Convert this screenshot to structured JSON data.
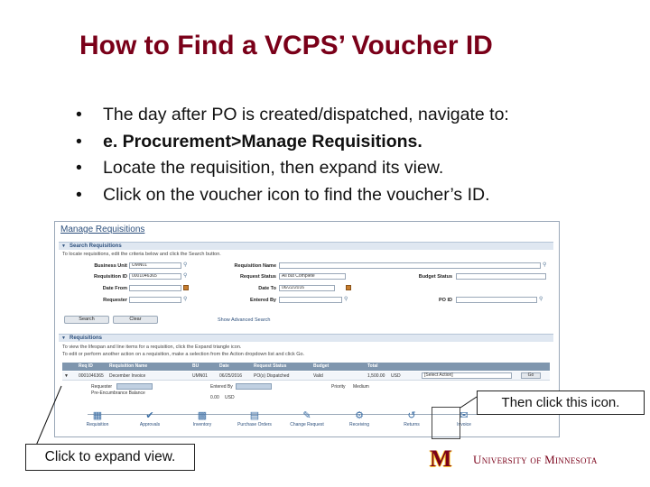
{
  "slide": {
    "title": "How to Find a VCPS’ Voucher ID",
    "bullets": [
      "The day after PO is created/dispatched, navigate to:",
      "e. Procurement>Manage Requisitions.",
      "Locate the requisition, then expand its view.",
      "Click on the voucher icon to find the voucher’s ID."
    ],
    "bullet_glyph": "•"
  },
  "screenshot": {
    "page_title": "Manage Requisitions",
    "search_section": "Search Requisitions",
    "search_note": "To locate requisitions, edit the criteria below and click the Search button.",
    "fields": {
      "business_unit_label": "Business Unit",
      "business_unit_value": "UMN01",
      "requisition_id_label": "Requisition ID",
      "requisition_id_value": "0001046365",
      "date_from_label": "Date From",
      "requester_label": "Requester",
      "requisition_name_label": "Requisition Name",
      "request_status_label": "Request Status",
      "request_status_value": "All but Complete",
      "date_to_label": "Date To",
      "date_to_value": "06/22/2016",
      "entered_by_label": "Entered By",
      "budget_status_label": "Budget Status",
      "po_id_label": "PO ID"
    },
    "search_button": "Search",
    "clear_button": "Clear",
    "advanced_link": "Show Advanced Search",
    "requisitions_section": "Requisitions",
    "req_note_1": "To view the lifespan and line items for a requisition, click the Expand triangle icon.",
    "req_note_2": "To edit or perform another action on a requisition, make a selection from the Action dropdown list and click Go.",
    "columns": [
      "Req ID",
      "Requisition Name",
      "BU",
      "Date",
      "Request Status",
      "Budget",
      "Total"
    ],
    "row": {
      "req_id": "0001046365",
      "name": "December Invoice",
      "bu": "UMN01",
      "date": "06/25/2016",
      "status": "PO(s) Dispatched",
      "budget": "Valid",
      "total": "1,500.00",
      "currency": "USD",
      "action": "[Select Action]",
      "go": "Go"
    },
    "sub": {
      "requester_label": "Requester",
      "entered_by_label": "Entered By",
      "priority_label": "Priority",
      "priority_value": "Medium",
      "pre_enc_label": "Pre-Encumbrance Balance",
      "pre_enc_value": "0.00",
      "pre_enc_currency": "USD"
    },
    "lifespan": [
      "Requisition",
      "Approvals",
      "Inventory",
      "Purchase Orders",
      "Change Request",
      "Receiving",
      "Returns",
      "Invoice"
    ]
  },
  "callouts": {
    "right": "Then click this icon.",
    "left": "Click to expand view."
  },
  "logo": {
    "mark": "M",
    "name": "University of Minnesota"
  },
  "colors": {
    "maroon": "#7a0019",
    "gold": "#ffcc33",
    "ps_blue": "#2c4f7c"
  }
}
